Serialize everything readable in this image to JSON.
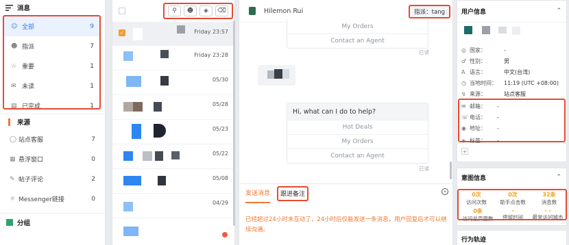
{
  "sidebar": {
    "messages_title": "消息",
    "filters": [
      {
        "icon": "people-icon",
        "label": "全部",
        "count": "9",
        "active": true
      },
      {
        "icon": "assign-icon",
        "label": "指派",
        "count": "7"
      },
      {
        "icon": "star-icon",
        "label": "重要",
        "count": "1"
      },
      {
        "icon": "mail-icon",
        "label": "未读",
        "count": "1"
      },
      {
        "icon": "done-icon",
        "label": "已完成",
        "count": "1"
      }
    ],
    "source_title": "来源",
    "sources": [
      {
        "icon": "chat-bubble-icon",
        "label": "站点客服",
        "count": "7"
      },
      {
        "icon": "window-icon",
        "label": "悬浮窗口",
        "count": "0"
      },
      {
        "icon": "comment-icon",
        "label": "帖子评论",
        "count": "2"
      },
      {
        "icon": "messenger-icon",
        "label": "Messenger链接",
        "count": "0"
      }
    ],
    "group_title": "分组"
  },
  "conversations": [
    {
      "date": "Friday 23:57",
      "selected": true
    },
    {
      "date": "Friday 23:28"
    },
    {
      "date": "05/30"
    },
    {
      "date": "05/28"
    },
    {
      "date": "05/23"
    },
    {
      "date": "05/22"
    },
    {
      "date": "05/08"
    },
    {
      "date": "04/29"
    }
  ],
  "chat": {
    "contact_name": "Hilemon Rui",
    "assignee_label": "指派：tang",
    "options_top": [
      "My Orders",
      "Contact an Agent"
    ],
    "read_label": "已读",
    "greeting": "Hi, what can I do to help?",
    "options_bottom": [
      "Hot Deals",
      "My Orders",
      "Contact an Agent"
    ],
    "tab_send": "发送消息",
    "tab_note": "跟进备注",
    "warning": "已经超过24小时未互动了，24小时后仅能发送一条消息，用户回复后才可以继续沟通。"
  },
  "user_info": {
    "title": "用户信息",
    "rows": [
      {
        "icon": "globe-icon",
        "key": "国家：",
        "value": "-"
      },
      {
        "icon": "gender-icon",
        "key": "性别：",
        "value": "男"
      },
      {
        "icon": "language-icon",
        "key": "语言：",
        "value": "中文(台湾)"
      },
      {
        "icon": "clock-icon",
        "key": "当地时间：",
        "value": "11:19 (UTC +08:00)"
      },
      {
        "icon": "source-icon",
        "key": "来源：",
        "value": "站点客服"
      }
    ],
    "contact_rows": [
      {
        "icon": "mail-icon",
        "key": "邮箱：",
        "value": "-"
      },
      {
        "icon": "phone-icon",
        "key": "电话：",
        "value": "-"
      },
      {
        "icon": "location-icon",
        "key": "地址：",
        "value": "-"
      }
    ],
    "tag_label": "标签：",
    "tag_value": "-"
  },
  "intent": {
    "title": "意图信息",
    "stats": [
      {
        "value": "0次",
        "label": "访问次数"
      },
      {
        "value": "0次",
        "label": "助手点击数"
      },
      {
        "value": "32条",
        "label": "消息数"
      },
      {
        "value": "0条",
        "label": "访问总页面数"
      },
      {
        "value": "-",
        "label": "停留时间"
      },
      {
        "value": "- -",
        "label": "最常访问城市"
      }
    ]
  },
  "behavior": {
    "title": "行为轨迹"
  },
  "colors": {
    "accent": "#2f7bf5",
    "highlight": "#e8492f",
    "warning": "#f0772d"
  }
}
